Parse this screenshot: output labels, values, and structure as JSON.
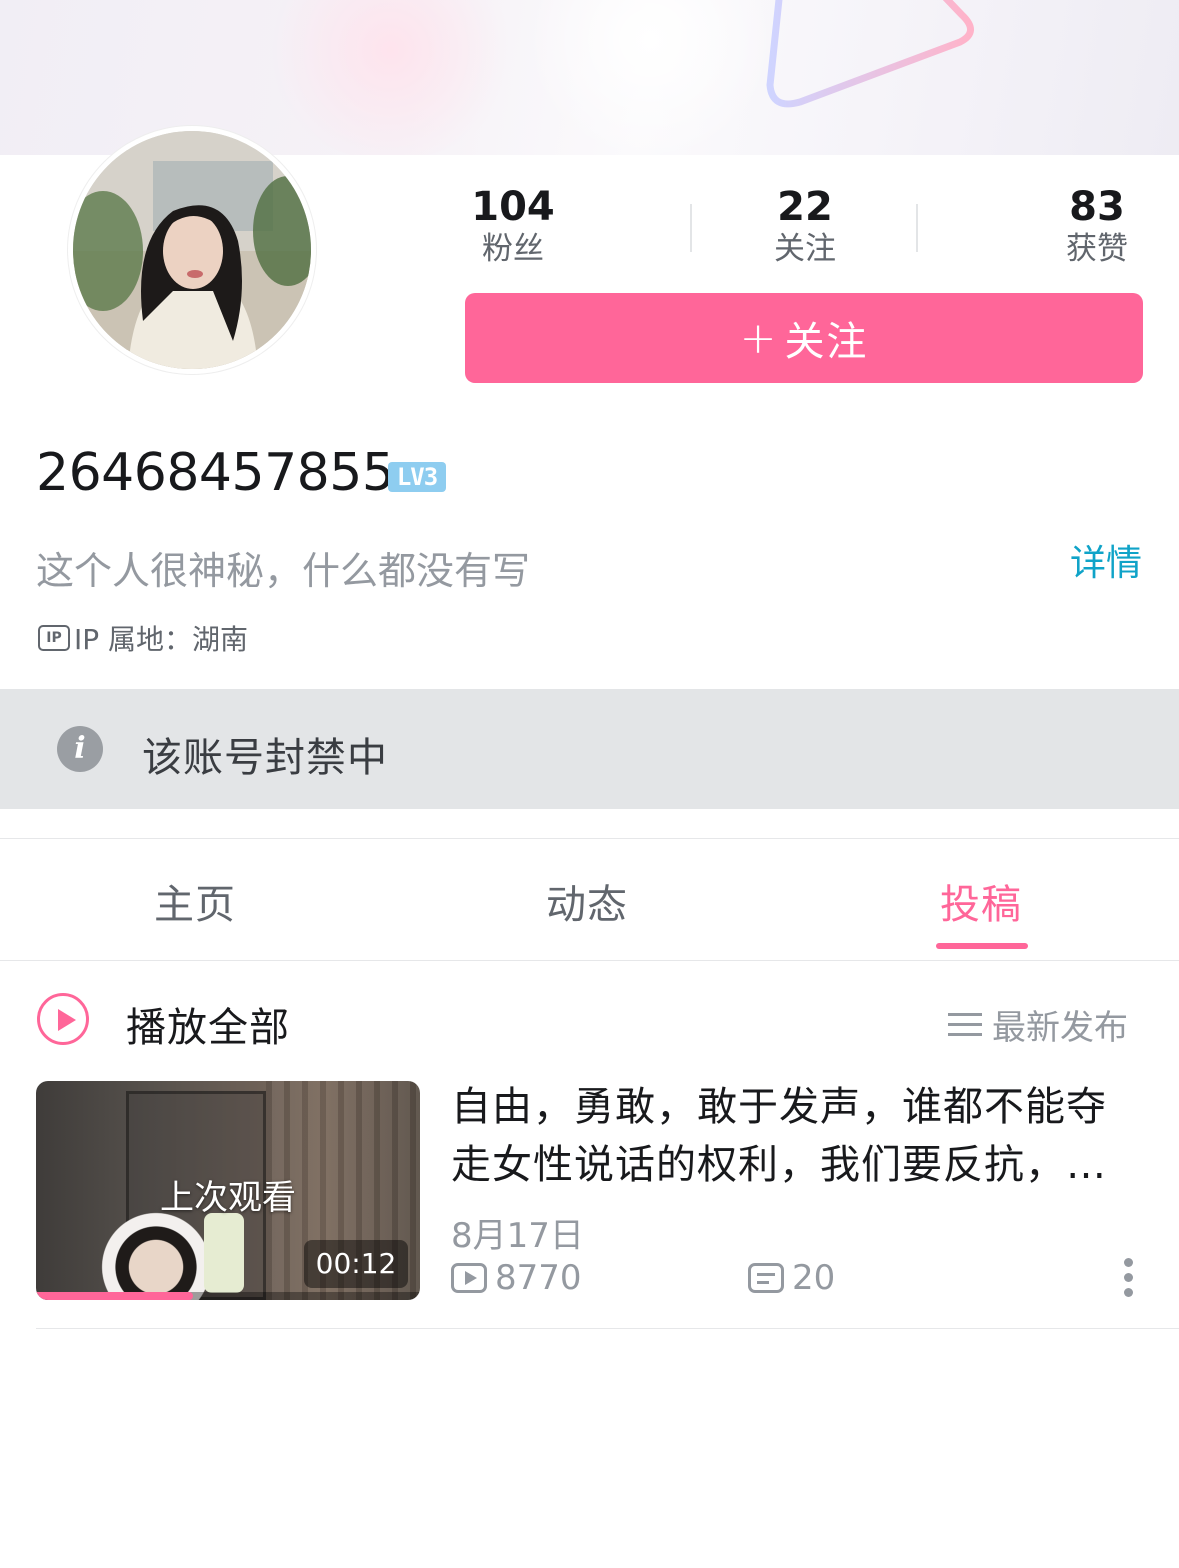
{
  "profile": {
    "uid": "26468457855",
    "level": "LV3",
    "bio": "这个人很神秘，什么都没有写",
    "detail_link": "详情",
    "ip_location": "IP 属地：湖南",
    "ip_icon": "ip-badge-icon"
  },
  "stats": [
    {
      "value": "104",
      "label": "粉丝"
    },
    {
      "value": "22",
      "label": "关注"
    },
    {
      "value": "83",
      "label": "获赞"
    }
  ],
  "follow_button": {
    "plus": "+",
    "label": "关注"
  },
  "notice": {
    "text": "该账号封禁中",
    "icon": "info-icon"
  },
  "tabs": [
    {
      "label": "主页",
      "active": false
    },
    {
      "label": "动态",
      "active": false
    },
    {
      "label": "投稿",
      "active": true
    }
  ],
  "list_header": {
    "play_all": "播放全部",
    "sort": "最新发布"
  },
  "videos": [
    {
      "title": "自由，勇敢，敢于发声，谁都不能夺走女性说话的权利，我们要反抗，…",
      "date": "8月17日",
      "overlay_label": "上次观看",
      "duration": "00:12",
      "watched_progress": 0.41,
      "plays": "8770",
      "danmaku": "20"
    }
  ],
  "colors": {
    "accent": "#ff6699",
    "link": "#0fa3c8",
    "level_badge": "#8ecdf0",
    "muted": "#9499a0"
  }
}
